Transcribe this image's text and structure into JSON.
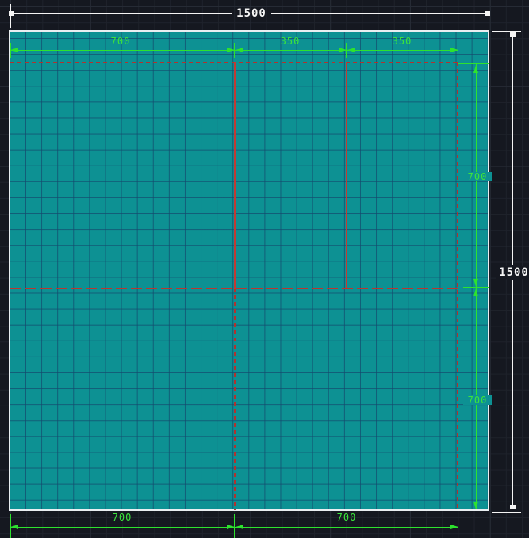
{
  "drawing": {
    "overall_width_label": "1500",
    "overall_height_label": "1500",
    "top_segment_labels": [
      "700",
      "350",
      "350"
    ],
    "right_segment_labels": [
      "700",
      "700"
    ],
    "bottom_segment_labels": [
      "700",
      "700"
    ]
  },
  "colors": {
    "background": "#151820",
    "panel_fill": "#0d9193",
    "panel_border": "#e9eef1",
    "dimension_green": "#2ee22e",
    "dimension_white": "#f4f4f4",
    "cut_line_red": "#c23a33",
    "offcut_dashed_red": "#b0332f"
  }
}
